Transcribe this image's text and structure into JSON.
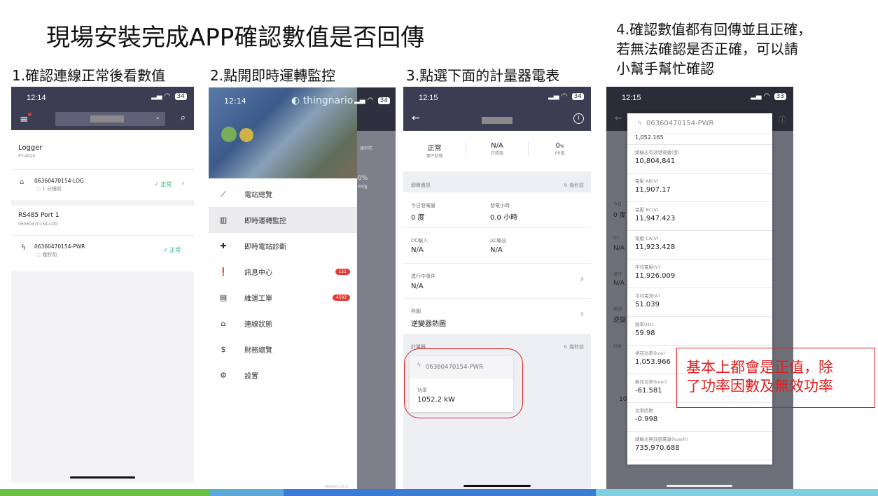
{
  "title": "現場安裝完成APP確認數值是否回傳",
  "steps": {
    "s1": "1.確認連線正常後看數值",
    "s2": "2.點開即時運轉監控",
    "s3": "3.點選下面的計量器電表",
    "s4_line1": "4.確認數值都有回傳並且正確，",
    "s4_line2": "若無法確認是否正確，可以請",
    "s4_line3": "小幫手幫忙確認"
  },
  "note": {
    "line1": "基本上都會是正值，除",
    "line2": "了功率因數及無效功率"
  },
  "phone1": {
    "time": "12:14",
    "battery": "34",
    "logger_title": "Logger",
    "logger_model": "PT-4020",
    "dev1_name": "06360470154-LOG",
    "dev1_time": "1 分鐘前",
    "dev1_status": "正常",
    "port_title": "RS485 Port 1",
    "port_sub": "06360470154-LOG",
    "dev2_name": "06360470154-PWR",
    "dev2_time": "幾秒前",
    "dev2_status": "正常"
  },
  "phone2": {
    "time": "12:14",
    "battery": "34",
    "brand": "thingnario",
    "version": "Version 1.8.3",
    "behind_label": "幾秒前",
    "behind_val": "0%",
    "behind_val2": "PR值",
    "menu": [
      "電站總覽",
      "即時運轉監控",
      "即時電站診斷",
      "訊息中心",
      "維運工單",
      "連線狀態",
      "財務總覽",
      "設置"
    ],
    "badge_messages": "151",
    "badge_orders": "4593"
  },
  "phone3": {
    "time": "12:15",
    "battery": "34",
    "kpi": [
      {
        "value": "正常",
        "label": "事件狀態"
      },
      {
        "value": "N/A",
        "label": "日照度"
      },
      {
        "value": "0",
        "unit": "%",
        "label": "PR值"
      }
    ],
    "realtime_header": "即時資訊",
    "realtime_time": "幾秒前",
    "today_label": "今日發電量",
    "today_value": "0 度",
    "hours_label": "發電小時",
    "hours_value": "0.0 小時",
    "dc_label": "DC輸入",
    "dc_value": "N/A",
    "ac_label": "AC輸出",
    "ac_value": "N/A",
    "event_label": "進行中事件",
    "event_value": "N/A",
    "heat_label": "熱圖",
    "heat_value": "逆變器熱圖",
    "meter_header": "計量器",
    "meter_time": "幾秒前",
    "meter_name": "06360470154-PWR",
    "power_label": "功率",
    "power_value": "1052.2 kW"
  },
  "phone4": {
    "time": "12:15",
    "battery": "33",
    "dialog_title": "06360470154-PWR",
    "top_value": "1,052.165",
    "items": [
      {
        "label": "總輸出有效發電量(度)",
        "value": "10,804,841"
      },
      {
        "label": "電壓 AB(V)",
        "value": "11,907.17"
      },
      {
        "label": "電壓 BC(V)",
        "value": "11,947.423"
      },
      {
        "label": "電壓 CA(V)",
        "value": "11,923.428"
      },
      {
        "label": "平均電壓(V)",
        "value": "11,926.009"
      },
      {
        "label": "平均電流(A)",
        "value": "51.039"
      },
      {
        "label": "頻率(Hz)",
        "value": "59.98"
      },
      {
        "label": "視在功率(kva)",
        "value": "1,053.966"
      },
      {
        "label": "無效功率(kvar)",
        "value": "-61.581"
      },
      {
        "label": "功率因數",
        "value": "-0.998"
      },
      {
        "label": "總輸出無效發電量(kvarh)",
        "value": "735,970.688"
      }
    ],
    "bg_labels": [
      "今日",
      "0 度",
      "DC",
      "N/A",
      "進行",
      "N/A",
      "熱圖",
      "逆變",
      "計量",
      "10"
    ]
  },
  "colors": {
    "appbar": "#3b3e52",
    "ok": "#2bb673",
    "badge": "#e53935",
    "note": "#e02020"
  }
}
